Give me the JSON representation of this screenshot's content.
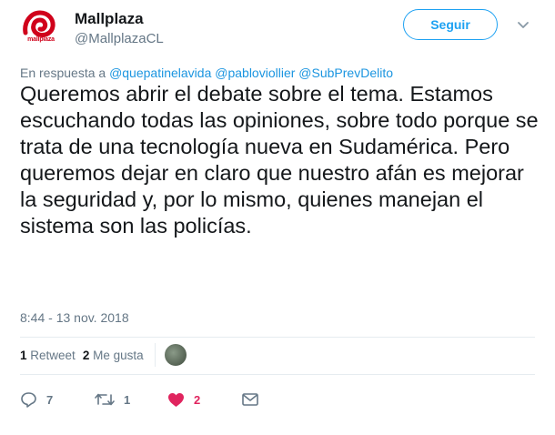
{
  "author": {
    "name": "Mallplaza",
    "handle": "@MallplazaCL",
    "logo_text": "mallplaza",
    "brand_color": "#d0021b"
  },
  "follow_button": {
    "label": "Seguir"
  },
  "reply": {
    "prefix": "En respuesta a ",
    "mentions": [
      "@quepatinelavida",
      "@pabloviollier",
      "@SubPrevDelito"
    ]
  },
  "tweet": {
    "text": "Queremos abrir el debate sobre el tema. Estamos escuchando todas las opiniones, sobre todo porque se trata de una tecnología nueva en Sudamérica. Pero queremos dejar en claro que nuestro afán es mejorar la seguridad y, por lo mismo, quienes manejan el sistema son las policías.",
    "timestamp": "8:44 - 13 nov. 2018"
  },
  "stats": {
    "retweets_count": "1",
    "retweets_label": "Retweet",
    "likes_count": "2",
    "likes_label": "Me gusta"
  },
  "actions": {
    "reply_count": "7",
    "retweet_count": "1",
    "like_count": "2",
    "like_color": "#e0245e"
  },
  "colors": {
    "link": "#1b95e0",
    "accent": "#1da1f2",
    "muted": "#657786"
  },
  "icons": [
    "caret-down-icon",
    "reply-icon",
    "retweet-icon",
    "heart-icon",
    "message-icon"
  ]
}
